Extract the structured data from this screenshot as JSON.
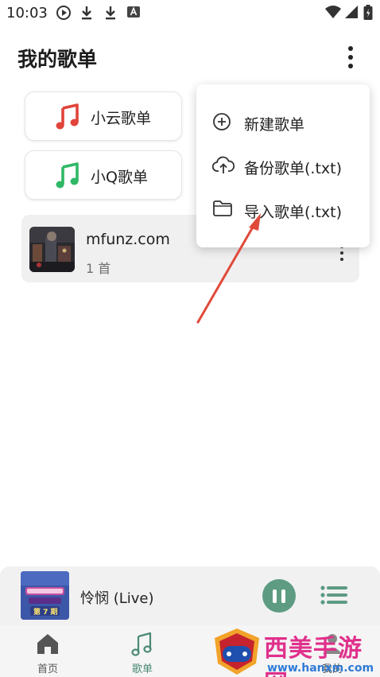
{
  "status_bar": {
    "time": "10:03",
    "left_icons": [
      "play-circle-icon",
      "download-icon",
      "download-icon",
      "font-icon"
    ],
    "right_icons": [
      "wifi-icon",
      "signal-icon",
      "battery-icon"
    ]
  },
  "header": {
    "title": "我的歌单",
    "more_icon": "more-vertical-icon"
  },
  "preset_playlists": [
    {
      "label": "小云歌单",
      "icon": "music-note-icon",
      "color": "#e0443a"
    },
    {
      "label": "小Q歌单",
      "icon": "music-note-icon",
      "color": "#2fb866"
    }
  ],
  "user_playlists": [
    {
      "name": "mfunz.com",
      "count": "1 首"
    }
  ],
  "menu": {
    "items": [
      {
        "label": "新建歌单",
        "icon": "add-circle-icon"
      },
      {
        "label": "备份歌单(.txt)",
        "icon": "cloud-upload-icon"
      },
      {
        "label": "导入歌单(.txt)",
        "icon": "folder-icon"
      }
    ]
  },
  "mini_player": {
    "title": "怜悯 (Live)",
    "cover_text": "第 7 期",
    "accent": "#5d9b83"
  },
  "bottom_nav": {
    "items": [
      {
        "label": "首页",
        "icon": "home-icon"
      },
      {
        "label": "歌单",
        "icon": "music-note-icon",
        "active": true
      },
      {
        "label": "我的",
        "icon": "person-icon"
      }
    ]
  },
  "watermark": {
    "text": "西美手游网",
    "url": "www.hanxm.com"
  }
}
